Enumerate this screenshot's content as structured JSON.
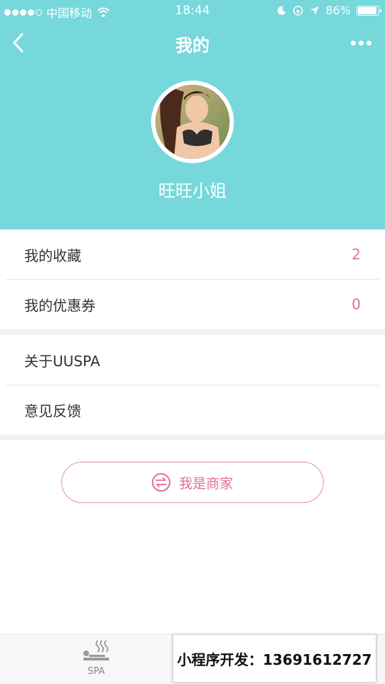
{
  "status_bar": {
    "carrier": "中国移动",
    "time": "18:44",
    "battery": "86%",
    "battery_level": 0.86,
    "signal_bars": 4
  },
  "nav": {
    "title": "我的",
    "back_icon": "chevron-left-icon",
    "more_icon": "more-horizontal-icon"
  },
  "profile": {
    "username": "旺旺小姐",
    "avatar_icon": "user-avatar-photo"
  },
  "list_groups": [
    {
      "items": [
        {
          "label": "我的收藏",
          "value": "2"
        },
        {
          "label": "我的优惠券",
          "value": "0"
        }
      ]
    },
    {
      "items": [
        {
          "label": "关于UUSPA"
        },
        {
          "label": "意见反馈"
        }
      ]
    }
  ],
  "merchant_button": {
    "label": "我是商家",
    "icon": "swap-icon"
  },
  "tabbar": {
    "tabs": [
      {
        "label": "SPA",
        "icon": "spa-icon"
      }
    ]
  },
  "promo": {
    "text": "小程序开发：13691612727"
  },
  "colors": {
    "header_bg": "#76d8db",
    "accent_pink": "#e56f9b",
    "list_text": "#333333",
    "page_bg": "#f2f2f2"
  }
}
